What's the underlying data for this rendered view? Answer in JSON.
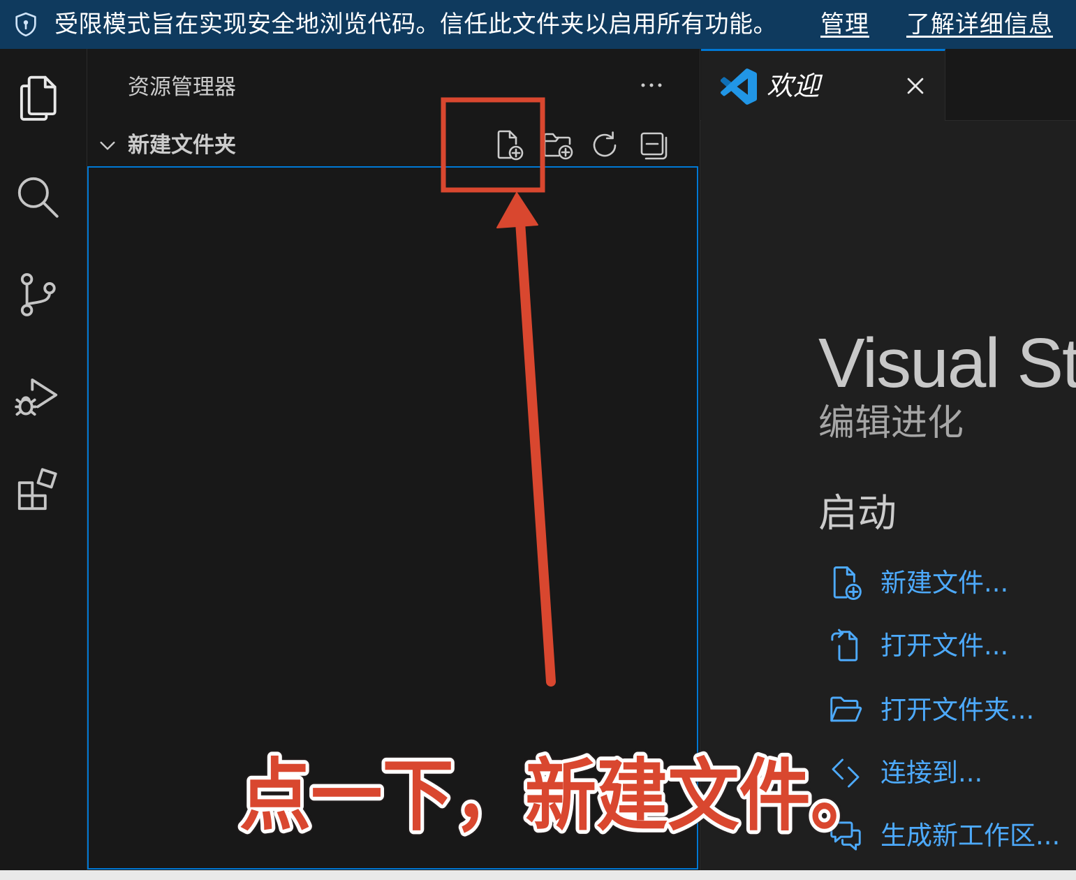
{
  "theme": {
    "banner_bg": "#0f3a5e",
    "activity_bg": "#181818",
    "sidebar_bg": "#181818",
    "editor_bg": "#1f1f1f",
    "focus_border": "#0078d4",
    "link_color": "#4daafc",
    "annotation_red": "#d9472f"
  },
  "banner": {
    "icon": "shield-icon",
    "message": "受限模式旨在实现安全地浏览代码。信任此文件夹以启用所有功能。",
    "manage_link": "管理",
    "learn_more_link": "了解详细信息"
  },
  "activity_bar": {
    "items": [
      {
        "icon": "files-icon",
        "active": true
      },
      {
        "icon": "search-icon",
        "active": false
      },
      {
        "icon": "source-control-icon",
        "active": false
      },
      {
        "icon": "run-debug-icon",
        "active": false
      },
      {
        "icon": "extensions-icon",
        "active": false
      }
    ]
  },
  "sidebar": {
    "title": "资源管理器",
    "more_icon": "ellipsis-icon",
    "folder": {
      "name": "新建文件夹",
      "expanded": true,
      "actions": [
        {
          "icon": "new-file-icon",
          "highlighted": true
        },
        {
          "icon": "new-folder-icon",
          "highlighted": false
        },
        {
          "icon": "refresh-icon",
          "highlighted": false
        },
        {
          "icon": "collapse-all-icon",
          "highlighted": false
        }
      ]
    }
  },
  "editor": {
    "tabs": [
      {
        "label": "欢迎",
        "icon": "vscode-logo-icon",
        "active": true,
        "preview": true
      }
    ],
    "welcome": {
      "title": "Visual St",
      "subtitle": "编辑进化",
      "start_heading": "启动",
      "start_items": [
        {
          "label": "新建文件...",
          "icon": "new-file-icon"
        },
        {
          "label": "打开文件...",
          "icon": "go-to-file-icon"
        },
        {
          "label": "打开文件夹...",
          "icon": "folder-opened-icon"
        },
        {
          "label": "连接到...",
          "icon": "remote-icon"
        },
        {
          "label": "生成新工作区...",
          "icon": "comment-discussion-icon"
        }
      ]
    }
  },
  "annotation": {
    "caption": "点一下，新建文件。"
  }
}
